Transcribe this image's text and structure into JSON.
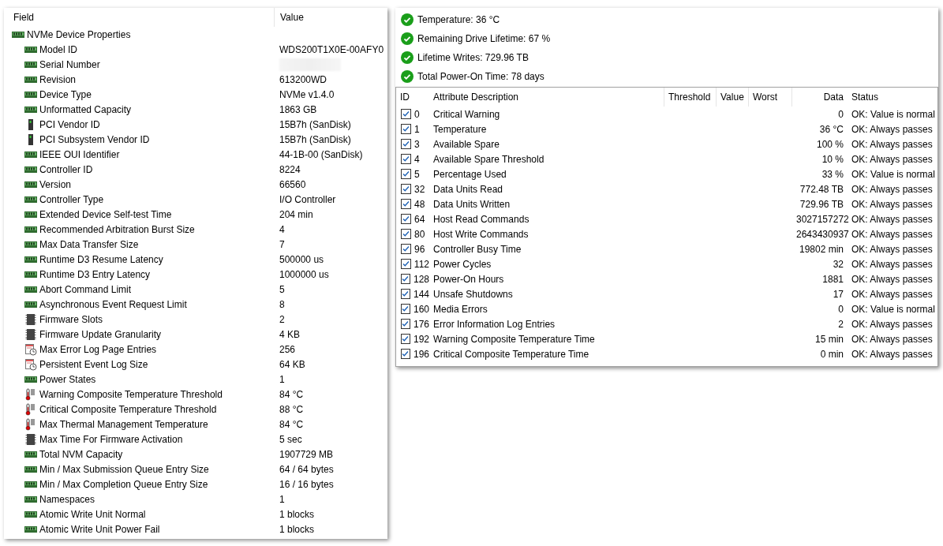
{
  "properties": {
    "columns": [
      "Field",
      "Value"
    ],
    "root": {
      "label": "NVMe Device Properties",
      "kind": "memory",
      "children": [
        {
          "kind": "memory",
          "field": "Model ID",
          "value": "WDS200T1X0E-00AFY0"
        },
        {
          "kind": "memory",
          "field": "Serial Number",
          "blurred": true
        },
        {
          "kind": "memory",
          "field": "Revision",
          "value": "613200WD"
        },
        {
          "kind": "memory",
          "field": "Device Type",
          "value": "NVMe v1.4.0"
        },
        {
          "kind": "memory",
          "field": "Unformatted Capacity",
          "value": "1863 GB"
        },
        {
          "kind": "pci",
          "field": "PCI Vendor ID",
          "value": "15B7h  (SanDisk)"
        },
        {
          "kind": "pci",
          "field": "PCI Subsystem Vendor ID",
          "value": "15B7h  (SanDisk)"
        },
        {
          "kind": "memory",
          "field": "IEEE OUI Identifier",
          "value": "44-1B-00  (SanDisk)"
        },
        {
          "kind": "memory",
          "field": "Controller ID",
          "value": "8224"
        },
        {
          "kind": "memory",
          "field": "Version",
          "value": "66560"
        },
        {
          "kind": "memory",
          "field": "Controller Type",
          "value": "I/O Controller"
        },
        {
          "kind": "memory",
          "field": "Extended Device Self-test Time",
          "value": "204 min"
        },
        {
          "kind": "memory",
          "field": "Recommended Arbitration Burst Size",
          "value": "4"
        },
        {
          "kind": "memory",
          "field": "Max Data Transfer Size",
          "value": "7"
        },
        {
          "kind": "memory",
          "field": "Runtime D3 Resume Latency",
          "value": "500000 us"
        },
        {
          "kind": "memory",
          "field": "Runtime D3 Entry Latency",
          "value": "1000000 us"
        },
        {
          "kind": "memory",
          "field": "Abort Command Limit",
          "value": "5"
        },
        {
          "kind": "memory",
          "field": "Asynchronous Event Request Limit",
          "value": "8"
        },
        {
          "kind": "chip",
          "field": "Firmware Slots",
          "value": "2"
        },
        {
          "kind": "chip",
          "field": "Firmware Update Granularity",
          "value": "4 KB"
        },
        {
          "kind": "log",
          "field": "Max Error Log Page Entries",
          "value": "256"
        },
        {
          "kind": "log",
          "field": "Persistent Event Log Size",
          "value": "64 KB"
        },
        {
          "kind": "memory",
          "field": "Power States",
          "value": "1"
        },
        {
          "kind": "thermo",
          "field": "Warning Composite Temperature Threshold",
          "value": "84 °C"
        },
        {
          "kind": "thermo",
          "field": "Critical Composite Temperature Threshold",
          "value": "88 °C"
        },
        {
          "kind": "thermo",
          "field": "Max Thermal Management Temperature",
          "value": "84 °C"
        },
        {
          "kind": "chip",
          "field": "Max Time For Firmware Activation",
          "value": "5 sec"
        },
        {
          "kind": "memory",
          "field": "Total NVM Capacity",
          "value": "1907729 MB"
        },
        {
          "kind": "memory",
          "field": "Min / Max Submission Queue Entry Size",
          "value": "64 / 64 bytes"
        },
        {
          "kind": "memory",
          "field": "Min / Max Completion Queue Entry Size",
          "value": "16 / 16 bytes"
        },
        {
          "kind": "memory",
          "field": "Namespaces",
          "value": "1"
        },
        {
          "kind": "memory",
          "field": "Atomic Write Unit Normal",
          "value": "1 blocks"
        },
        {
          "kind": "memory",
          "field": "Atomic Write Unit Power Fail",
          "value": "1 blocks"
        }
      ]
    }
  },
  "summary": [
    {
      "text": "Temperature: 36 °C",
      "ok": true
    },
    {
      "text": "Remaining Drive Lifetime: 67 %",
      "ok": true
    },
    {
      "text": "Lifetime Writes: 729.96 TB",
      "ok": true
    },
    {
      "text": "Total Power-On Time: 78 days",
      "ok": true
    }
  ],
  "attributes": {
    "columns": [
      "ID",
      "Attribute Description",
      "Threshold",
      "Value",
      "Worst",
      "Data",
      "Status"
    ],
    "rows": [
      {
        "checked": true,
        "id": "0",
        "description": "Critical Warning",
        "data": "0",
        "status": "OK: Value is normal"
      },
      {
        "checked": true,
        "id": "1",
        "description": "Temperature",
        "data": "36 °C",
        "status": "OK: Always passes"
      },
      {
        "checked": true,
        "id": "3",
        "description": "Available Spare",
        "data": "100 %",
        "status": "OK: Always passes"
      },
      {
        "checked": true,
        "id": "4",
        "description": "Available Spare Threshold",
        "data": "10 %",
        "status": "OK: Always passes"
      },
      {
        "checked": true,
        "id": "5",
        "description": "Percentage Used",
        "data": "33 %",
        "status": "OK: Value is normal"
      },
      {
        "checked": true,
        "id": "32",
        "description": "Data Units Read",
        "data": "772.48 TB",
        "status": "OK: Always passes"
      },
      {
        "checked": true,
        "id": "48",
        "description": "Data Units Written",
        "data": "729.96 TB",
        "status": "OK: Always passes"
      },
      {
        "checked": true,
        "id": "64",
        "description": "Host Read Commands",
        "data": "3027157272",
        "status": "OK: Always passes"
      },
      {
        "checked": true,
        "id": "80",
        "description": "Host Write Commands",
        "data": "2643430937",
        "status": "OK: Always passes"
      },
      {
        "checked": true,
        "id": "96",
        "description": "Controller Busy Time",
        "data": "19802 min",
        "status": "OK: Always passes"
      },
      {
        "checked": true,
        "id": "112",
        "description": "Power Cycles",
        "data": "32",
        "status": "OK: Always passes"
      },
      {
        "checked": true,
        "id": "128",
        "description": "Power-On Hours",
        "data": "1881",
        "status": "OK: Always passes"
      },
      {
        "checked": true,
        "id": "144",
        "description": "Unsafe Shutdowns",
        "data": "17",
        "status": "OK: Always passes"
      },
      {
        "checked": true,
        "id": "160",
        "description": "Media Errors",
        "data": "0",
        "status": "OK: Value is normal"
      },
      {
        "checked": true,
        "id": "176",
        "description": "Error Information Log Entries",
        "data": "2",
        "status": "OK: Always passes"
      },
      {
        "checked": true,
        "id": "192",
        "description": "Warning Composite Temperature Time",
        "data": "15 min",
        "status": "OK: Always passes"
      },
      {
        "checked": true,
        "id": "196",
        "description": "Critical Composite Temperature Time",
        "data": "0 min",
        "status": "OK: Always passes"
      }
    ]
  }
}
